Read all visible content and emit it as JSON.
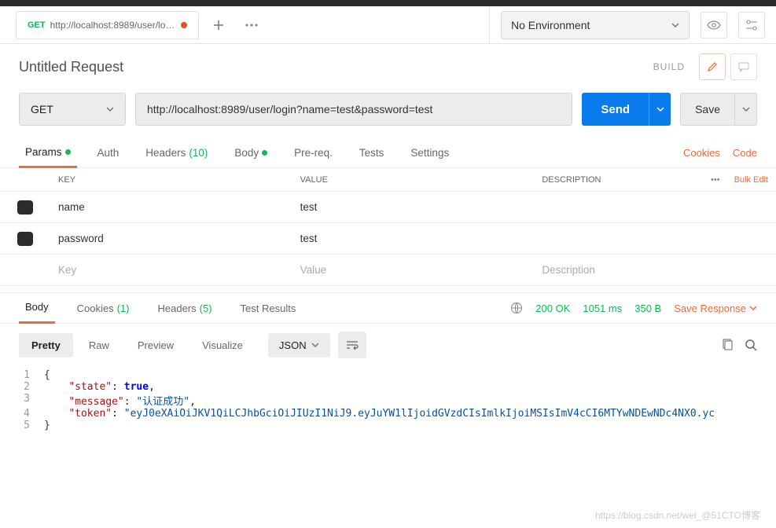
{
  "tab": {
    "method": "GET",
    "title": "http://localhost:8989/user/login..."
  },
  "env": {
    "label": "No Environment"
  },
  "request": {
    "title": "Untitled Request",
    "build": "BUILD",
    "method": "GET",
    "url": "http://localhost:8989/user/login?name=test&password=test",
    "send": "Send",
    "save": "Save"
  },
  "reqTabs": {
    "params": "Params",
    "auth": "Auth",
    "headers": "Headers",
    "headersCount": "(10)",
    "body": "Body",
    "prereq": "Pre-req.",
    "tests": "Tests",
    "settings": "Settings",
    "cookies": "Cookies",
    "code": "Code"
  },
  "paramsTable": {
    "headers": {
      "key": "KEY",
      "value": "VALUE",
      "desc": "DESCRIPTION",
      "bulk": "Bulk Edit"
    },
    "rows": [
      {
        "key": "name",
        "value": "test"
      },
      {
        "key": "password",
        "value": "test"
      }
    ],
    "placeholders": {
      "key": "Key",
      "value": "Value",
      "desc": "Description"
    }
  },
  "respTabs": {
    "body": "Body",
    "cookies": "Cookies",
    "cookiesCount": "(1)",
    "headers": "Headers",
    "headersCount": "(5)",
    "tests": "Test Results"
  },
  "respMeta": {
    "status": "200 OK",
    "time": "1051 ms",
    "size": "350 B",
    "save": "Save Response"
  },
  "view": {
    "pretty": "Pretty",
    "raw": "Raw",
    "preview": "Preview",
    "visualize": "Visualize",
    "format": "JSON"
  },
  "body": {
    "l1": "{",
    "l2_key": "\"state\"",
    "l2_val": "true",
    "l2_sep": ": ",
    "l2_end": ",",
    "l3_key": "\"message\"",
    "l3_val": "\"认证成功\"",
    "l3_end": ",",
    "l4_key": "\"token\"",
    "l4_val": "\"eyJ0eXAiOiJKV1QiLCJhbGciOiJIUzI1NiJ9.eyJuYW1lIjoidGVzdCIsImlkIjoiMSIsImV4cCI6MTYwNDEwNDc4NX0.yc",
    "l5": "}"
  },
  "watermark": "https://blog.csdn.net/wei_@51CTO博客"
}
